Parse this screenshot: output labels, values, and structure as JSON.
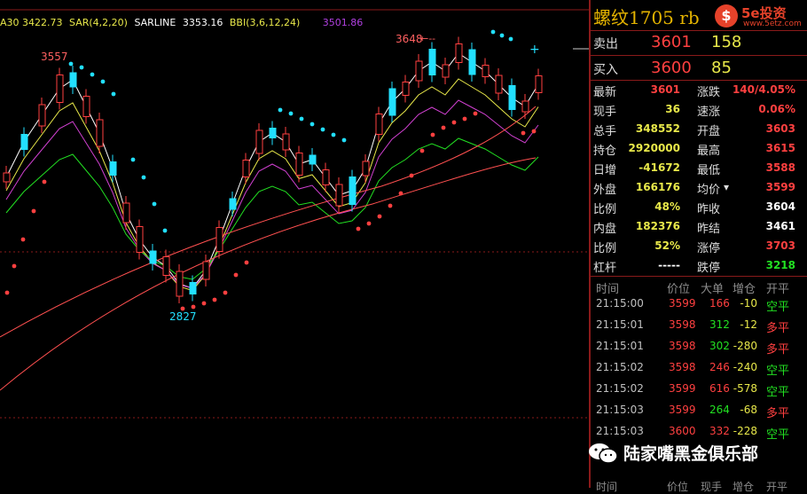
{
  "legend": {
    "ma": "A30 3422.73",
    "sar": "SAR(4,2,20)",
    "sarline": "SARLINE",
    "sarline_value": "3353.16",
    "bbi": "BBI(3,6,12,24)",
    "bbi_value": "3501.86"
  },
  "chart": {
    "annotations": {
      "high": "3557",
      "low": "2827",
      "peak": "3648"
    }
  },
  "header": {
    "title": "螺纹1705 rb",
    "logo_text": "5e投资",
    "logo_url": "www.5etz.com",
    "logo_mark": "$"
  },
  "book": {
    "ask": {
      "label": "卖出",
      "price": "3601",
      "volume": "158"
    },
    "bid": {
      "label": "买入",
      "price": "3600",
      "volume": "85"
    }
  },
  "quote_rows": [
    {
      "l1": "最新",
      "v1": "3601",
      "c1": "red",
      "l2": "涨跌",
      "v2": "140/4.05%",
      "c2": "red"
    },
    {
      "l1": "现手",
      "v1": "36",
      "c1": "yellow",
      "l2": "速涨",
      "v2": "0.06%",
      "c2": "red"
    },
    {
      "l1": "总手",
      "v1": "348552",
      "c1": "yellow",
      "l2": "开盘",
      "v2": "3603",
      "c2": "red"
    },
    {
      "l1": "持仓",
      "v1": "2920000",
      "c1": "yellow",
      "l2": "最高",
      "v2": "3615",
      "c2": "red"
    },
    {
      "l1": "日增",
      "v1": "-41672",
      "c1": "yellow",
      "l2": "最低",
      "v2": "3588",
      "c2": "red"
    },
    {
      "l1": "外盘",
      "v1": "166176",
      "c1": "yellow",
      "l2": "均价",
      "v2": "3599",
      "c2": "red"
    },
    {
      "l1": "比例",
      "v1": "48%",
      "c1": "yellow",
      "l2": "昨收",
      "v2": "3604",
      "c2": "white"
    },
    {
      "l1": "内盘",
      "v1": "182376",
      "c1": "yellow",
      "l2": "昨结",
      "v2": "3461",
      "c2": "white"
    },
    {
      "l1": "比例",
      "v1": "52%",
      "c1": "yellow",
      "l2": "涨停",
      "v2": "3703",
      "c2": "red"
    },
    {
      "l1": "杠杆",
      "v1": "-----",
      "c1": "white",
      "l2": "跌停",
      "v2": "3218",
      "c2": "green"
    }
  ],
  "ticks_header": {
    "time": "时间",
    "price": "价位",
    "big": "大单",
    "oi": "增仓",
    "kind": "开平"
  },
  "ticks": [
    {
      "time": "21:15:00",
      "price": "3599",
      "big": "166",
      "bc": "red",
      "oi": "-10",
      "kind": "空平",
      "kc": "green"
    },
    {
      "time": "21:15:01",
      "price": "3598",
      "big": "312",
      "bc": "green",
      "oi": "-12",
      "kind": "多平",
      "kc": "red"
    },
    {
      "time": "21:15:01",
      "price": "3598",
      "big": "302",
      "bc": "green",
      "oi": "-280",
      "kind": "多平",
      "kc": "red"
    },
    {
      "time": "21:15:02",
      "price": "3598",
      "big": "246",
      "bc": "red",
      "oi": "-240",
      "kind": "空平",
      "kc": "green"
    },
    {
      "time": "21:15:02",
      "price": "3599",
      "big": "616",
      "bc": "red",
      "oi": "-578",
      "kind": "空平",
      "kc": "green"
    },
    {
      "time": "21:15:03",
      "price": "3599",
      "big": "264",
      "bc": "green",
      "oi": "-68",
      "kind": "多平",
      "kc": "red"
    },
    {
      "time": "21:15:03",
      "price": "3600",
      "big": "332",
      "bc": "red",
      "oi": "-228",
      "kind": "空平",
      "kc": "green"
    }
  ],
  "bottom_header": {
    "time": "时间",
    "price": "价位",
    "now": "现手",
    "oi": "增仓",
    "kind": "开平"
  },
  "watermark": {
    "text": "陆家嘴黑金俱乐部"
  },
  "colors": {
    "up": "#ff4040",
    "down": "#22e0ff",
    "accent": "#e5b400",
    "grid": "#8a1a1a"
  }
}
